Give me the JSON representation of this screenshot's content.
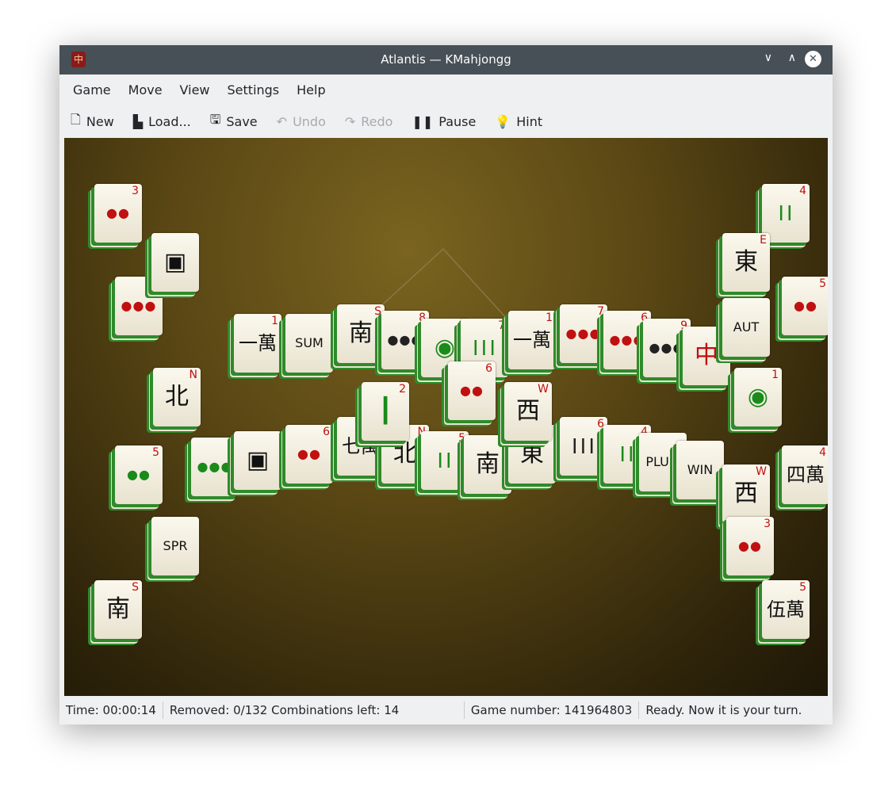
{
  "window": {
    "title": "Atlantis — KMahjongg",
    "app_icon": "mahjong-tile-icon"
  },
  "menu": [
    "Game",
    "Move",
    "View",
    "Settings",
    "Help"
  ],
  "toolbar": [
    {
      "label": "New",
      "icon": "new-document-icon",
      "enabled": true
    },
    {
      "label": "Load...",
      "icon": "folder-icon",
      "enabled": true
    },
    {
      "label": "Save",
      "icon": "floppy-icon",
      "enabled": true
    },
    {
      "label": "Undo",
      "icon": "undo-icon",
      "enabled": false
    },
    {
      "label": "Redo",
      "icon": "redo-icon",
      "enabled": false
    },
    {
      "label": "Pause",
      "icon": "pause-icon",
      "enabled": true
    },
    {
      "label": "Hint",
      "icon": "lightbulb-icon",
      "enabled": true
    }
  ],
  "tiles": [
    {
      "face": "一萬",
      "corner": "1",
      "color": "#111"
    },
    {
      "face": "SUM",
      "corner": "",
      "color": "#111"
    },
    {
      "face": "南",
      "corner": "S",
      "color": "#111"
    },
    {
      "face": "●●●",
      "corner": "8",
      "color": "#222"
    },
    {
      "face": "◉",
      "corner": "1",
      "color": "#1a8a1a"
    },
    {
      "face": "┃┃┃",
      "corner": "7",
      "color": "#1a8a1a"
    },
    {
      "face": "一萬",
      "corner": "1",
      "color": "#111"
    },
    {
      "face": "●●●",
      "corner": "7",
      "color": "#c01010"
    },
    {
      "face": "●●●",
      "corner": "6",
      "color": "#c01010"
    },
    {
      "face": "●●●",
      "corner": "9",
      "color": "#222"
    },
    {
      "face": "中",
      "corner": "C",
      "color": "#c01010"
    },
    {
      "face": "●●●",
      "corner": "9",
      "color": "#1a8a1a"
    },
    {
      "face": "▣",
      "corner": "",
      "color": "#111"
    },
    {
      "face": "●●",
      "corner": "6",
      "color": "#c01010"
    },
    {
      "face": "七萬",
      "corner": "7",
      "color": "#111"
    },
    {
      "face": "北",
      "corner": "N",
      "color": "#111"
    },
    {
      "face": "┃┃",
      "corner": "5",
      "color": "#1a8a1a"
    },
    {
      "face": "南",
      "corner": "S",
      "color": "#111"
    },
    {
      "face": "東",
      "corner": "E",
      "color": "#111"
    },
    {
      "face": "┃┃┃",
      "corner": "6",
      "color": "#222"
    },
    {
      "face": "┃┃",
      "corner": "4",
      "color": "#1a8a1a"
    },
    {
      "face": "PLUM",
      "corner": "",
      "color": "#111"
    },
    {
      "face": "WIN",
      "corner": "",
      "color": "#111"
    },
    {
      "face": "┃",
      "corner": "2",
      "color": "#1a8a1a"
    },
    {
      "face": "●●",
      "corner": "6",
      "color": "#c01010"
    },
    {
      "face": "西",
      "corner": "W",
      "color": "#111"
    },
    {
      "face": "●●",
      "corner": "3",
      "color": "#c01010"
    },
    {
      "face": "●●●",
      "corner": "7",
      "color": "#c01010"
    },
    {
      "face": "▣",
      "corner": "",
      "color": "#111"
    },
    {
      "face": "北",
      "corner": "N",
      "color": "#111"
    },
    {
      "face": "●●",
      "corner": "5",
      "color": "#1a8a1a"
    },
    {
      "face": "SPR",
      "corner": "",
      "color": "#111"
    },
    {
      "face": "南",
      "corner": "S",
      "color": "#111"
    },
    {
      "face": "┃┃",
      "corner": "4",
      "color": "#1a8a1a"
    },
    {
      "face": "東",
      "corner": "E",
      "color": "#111"
    },
    {
      "face": "AUT",
      "corner": "",
      "color": "#111"
    },
    {
      "face": "●●",
      "corner": "5",
      "color": "#c01010"
    },
    {
      "face": "◉",
      "corner": "1",
      "color": "#1a8a1a"
    },
    {
      "face": "四萬",
      "corner": "4",
      "color": "#111"
    },
    {
      "face": "西",
      "corner": "W",
      "color": "#111"
    },
    {
      "face": "●●",
      "corner": "3",
      "color": "#c01010"
    },
    {
      "face": "伍萬",
      "corner": "5",
      "color": "#111"
    }
  ],
  "status": {
    "time": "Time: 00:00:14",
    "removed": "Removed: 0/132  Combinations left: 14",
    "game_number": "Game number: 141964803",
    "message": "Ready. Now it is your turn."
  }
}
